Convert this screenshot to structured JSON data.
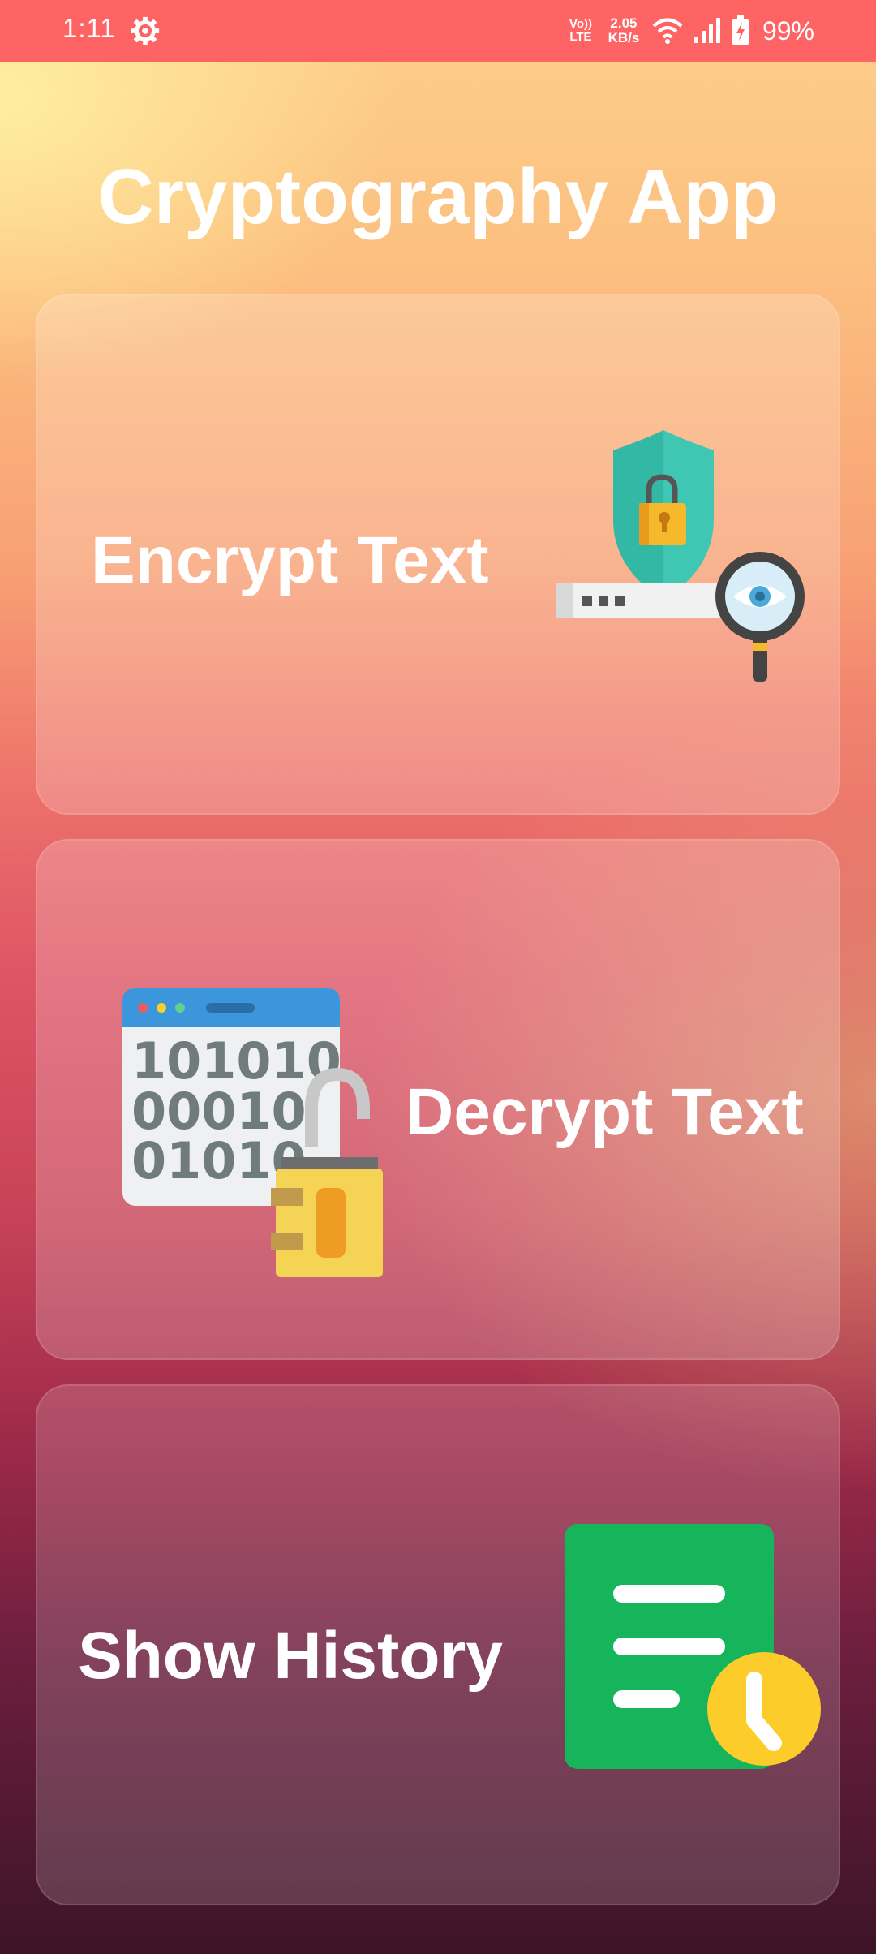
{
  "status_bar": {
    "time": "1:11",
    "volte_top": "Vo))",
    "volte_bottom": "LTE",
    "speed_value": "2.05",
    "speed_unit": "KB/s",
    "battery": "99%"
  },
  "app": {
    "title": "Cryptography App"
  },
  "cards": {
    "encrypt": {
      "label": "Encrypt Text",
      "icon": "shield-lock-eye-icon"
    },
    "decrypt": {
      "label": "Decrypt Text",
      "icon": "binary-unlock-icon",
      "binary_lines": [
        "101010",
        "00010",
        "01010"
      ]
    },
    "history": {
      "label": "Show History",
      "icon": "document-clock-icon"
    }
  },
  "colors": {
    "status_bar": "#ff6464",
    "shield": "#3fc7b4",
    "lock": "#f6b92b",
    "eye": "#4aa9d8",
    "history_doc": "#16b55b",
    "clock": "#fccc2a"
  }
}
